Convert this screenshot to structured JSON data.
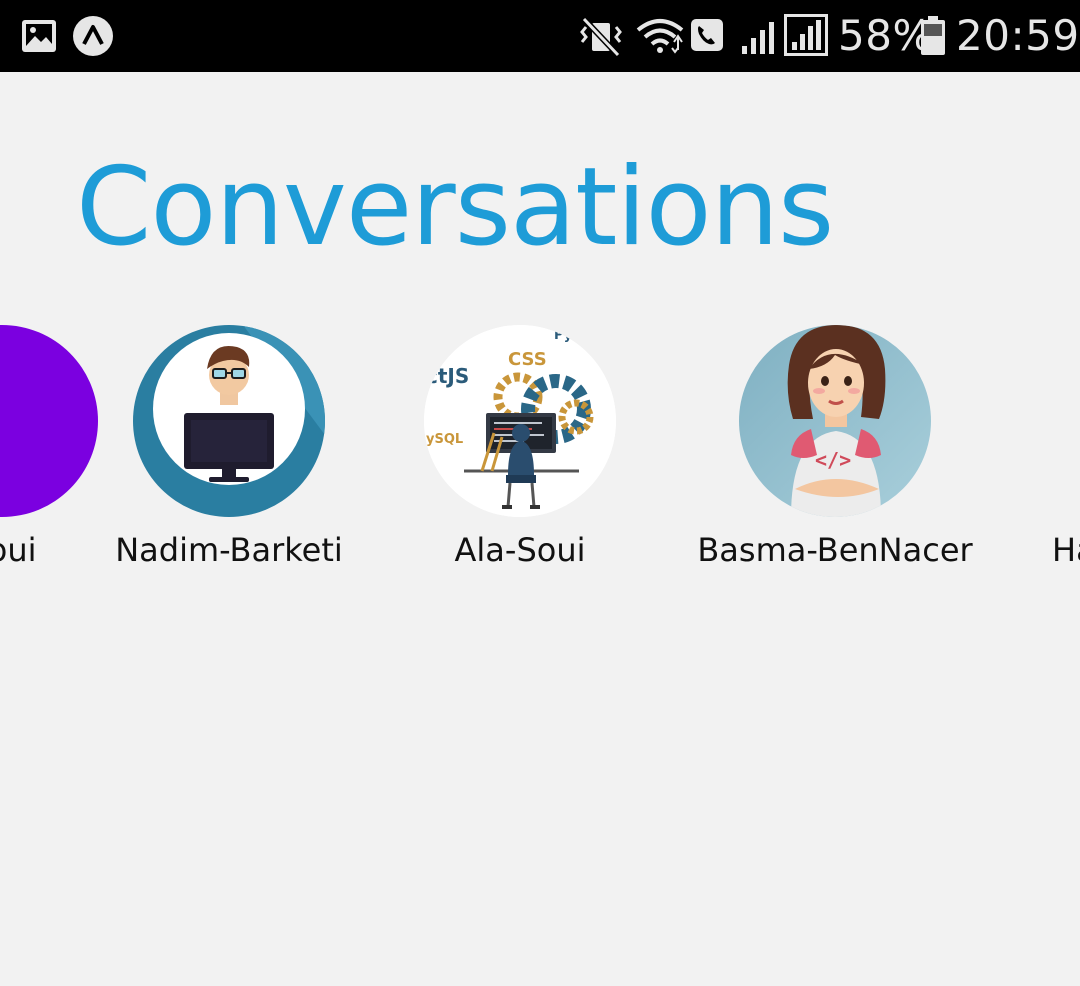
{
  "status_bar": {
    "battery_percent": "58%",
    "time": "20:59",
    "icons": [
      "gallery-icon",
      "app-notification-icon",
      "vibrate-mute-icon",
      "wifi-icon",
      "wifi-call-icon",
      "signal-icon",
      "signal-alt-icon",
      "battery-icon"
    ]
  },
  "page": {
    "title": "Conversations"
  },
  "contacts": [
    {
      "name": "Soui"
    },
    {
      "name": "Nadim-Barketi"
    },
    {
      "name": "Ala-Soui"
    },
    {
      "name": "Basma-BenNacer"
    },
    {
      "name": "Ha"
    }
  ],
  "avatar_art": {
    "texts": [
      "ctJS",
      "CSS",
      "Py",
      "ySQL",
      "</>"
    ]
  },
  "colors": {
    "accent": "#1e9cd7",
    "purple_avatar": "#7b00e0"
  }
}
